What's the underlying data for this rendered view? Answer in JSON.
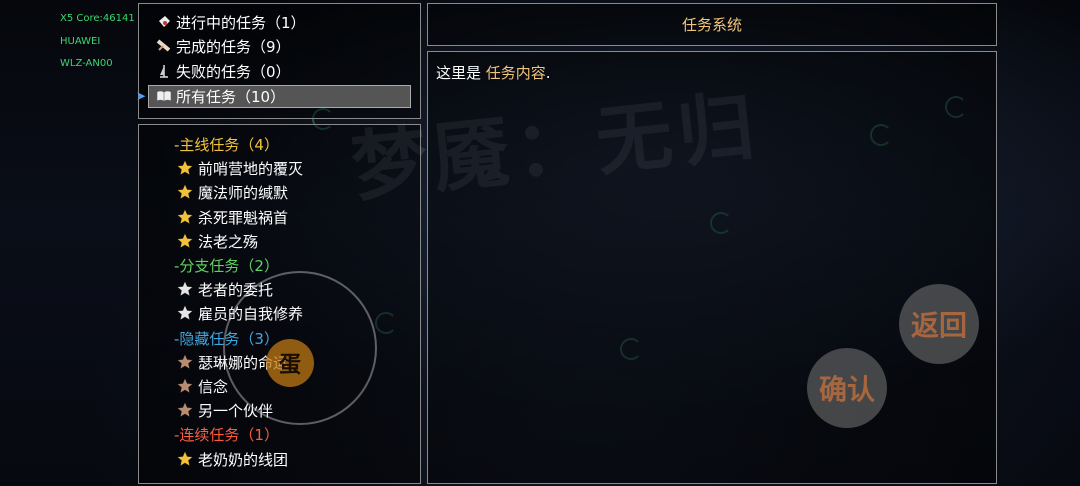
{
  "debug": {
    "core": "X5 Core:46141",
    "brand": "HUAWEI",
    "model": "WLZ-AN00"
  },
  "categories": [
    {
      "label": "进行中的任务（1）",
      "icon": "scroll-sealed-icon"
    },
    {
      "label": "完成的任务（9）",
      "icon": "scroll-open-icon"
    },
    {
      "label": "失败的任务（0）",
      "icon": "broken-flag-icon"
    },
    {
      "label": "所有任务（10）",
      "icon": "book-icon",
      "selected": true
    }
  ],
  "groups": [
    {
      "header": "-主线任务（4）",
      "color": "#f2c23c",
      "items": [
        "前哨营地的覆灭",
        "魔法师的缄默",
        "杀死罪魁祸首",
        "法老之殇"
      ],
      "star": "gold"
    },
    {
      "header": "-分支任务（2）",
      "color": "#5fd35f",
      "items": [
        "老者的委托",
        "雇员的自我修养"
      ],
      "star": "silver"
    },
    {
      "header": "-隐藏任务（3）",
      "color": "#3fa8e0",
      "items": [
        "瑟琳娜的命运",
        "信念",
        "另一个伙伴"
      ],
      "star": "bronze"
    },
    {
      "header": "-连续任务（1）",
      "color": "#ff5a3c",
      "items": [
        "老奶奶的线团"
      ],
      "star": "gold-large"
    }
  ],
  "panel_title": "任务系统",
  "content": {
    "prefix": "这里是 ",
    "highlight": "任务内容",
    "suffix": "."
  },
  "watermark": "梦魇：无归",
  "buttons": {
    "back": "返回",
    "confirm": "确认",
    "joystick": "蛋"
  },
  "colors": {
    "gold": "#f2c23c",
    "silver": "#e6e6e6",
    "bronze": "#b98c72",
    "title": "#f2c57c"
  }
}
